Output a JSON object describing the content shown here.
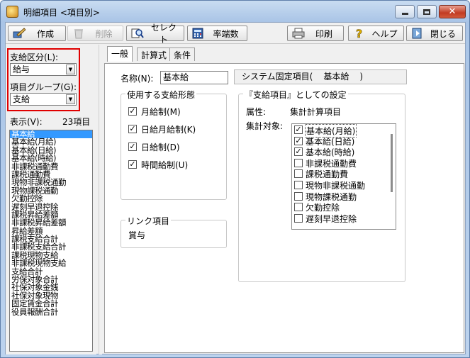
{
  "window": {
    "title": "明細項目 <項目別>",
    "close_glyph": "✕"
  },
  "toolbar": {
    "create": "作成",
    "delete": "削除",
    "select": "セレクト",
    "rate": "率端数",
    "print": "印刷",
    "help": "ヘルプ",
    "close": "閉じる"
  },
  "left": {
    "kubun_label": "支給区分(L):",
    "kubun_value": "給与",
    "group_label": "項目グループ(G):",
    "group_value": "支給",
    "display_label": "表示(V):",
    "count": "23項目",
    "items": [
      "基本給",
      "基本給(月給)",
      "基本給(日給)",
      "基本給(時給)",
      "非課税通勤費",
      "課税通勤費",
      "現物非課税通勤",
      "現物課税通勤",
      "欠勤控除",
      "遅刻早退控除",
      "課税昇給差額",
      "非課税昇給差額",
      "昇給差額",
      "課税支給合計",
      "非課税支給合計",
      "課税現物支給",
      "非課税現物支給",
      "支給合計",
      "労保対象合計",
      "社保対象金銭",
      "社保対象現物",
      "固定賃金合計",
      "役員報酬合計"
    ],
    "selected_index": 0
  },
  "tabs": [
    "一般",
    "計算式",
    "条件"
  ],
  "general": {
    "name_label": "名称(N):",
    "name_value": "基本給",
    "fixed_prefix": "システム固定項目(",
    "fixed_value": "基本給",
    "fixed_suffix": ")",
    "form_title": "使用する支給形態",
    "forms": [
      {
        "label": "月給制(M)",
        "checked": true
      },
      {
        "label": "日給月給制(K)",
        "checked": true
      },
      {
        "label": "日給制(D)",
        "checked": true
      },
      {
        "label": "時間給制(U)",
        "checked": true
      }
    ],
    "setting_title": "『支給項目』としての設定",
    "attr_label": "属性:",
    "attr_value": "集計計算項目",
    "target_label": "集計対象:",
    "targets": [
      {
        "label": "基本給(月給)",
        "checked": true
      },
      {
        "label": "基本給(日給)",
        "checked": true
      },
      {
        "label": "基本給(時給)",
        "checked": true
      },
      {
        "label": "非課税通勤費",
        "checked": false
      },
      {
        "label": "課税通勤費",
        "checked": false
      },
      {
        "label": "現物非課税通勤",
        "checked": false
      },
      {
        "label": "現物課税通勤",
        "checked": false
      },
      {
        "label": "欠勤控除",
        "checked": false
      },
      {
        "label": "遅刻早退控除",
        "checked": false
      }
    ],
    "link_title": "リンク項目",
    "link_value": "賞与"
  },
  "colors": {
    "selection": "#3399ff",
    "highlight": "#e00000"
  }
}
